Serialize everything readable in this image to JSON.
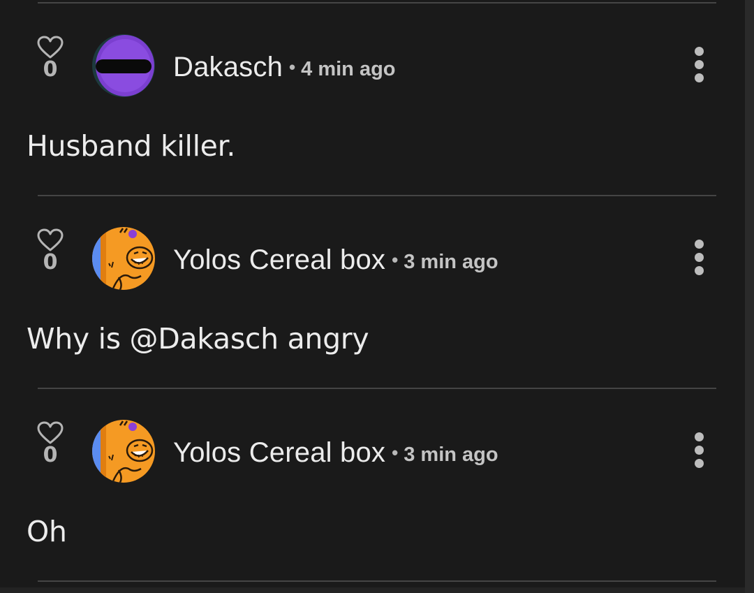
{
  "comments": [
    {
      "likes": "0",
      "author": "Dakasch",
      "separator": "•",
      "time": "4 min ago",
      "text": "Husband killer.",
      "avatar": "purple-face-avatar"
    },
    {
      "likes": "0",
      "author": "Yolos Cereal box",
      "separator": "•",
      "time": "3 min ago",
      "text": "Why is @Dakasch angry",
      "avatar": "orange-cartoon-avatar"
    },
    {
      "likes": "0",
      "author": "Yolos Cereal box",
      "separator": "•",
      "time": "3 min ago",
      "text": "Oh",
      "avatar": "orange-cartoon-avatar"
    }
  ],
  "colors": {
    "background": "#1a1a1a",
    "divider": "#454545",
    "text": "#ececec",
    "muted": "#b5b5b5"
  }
}
